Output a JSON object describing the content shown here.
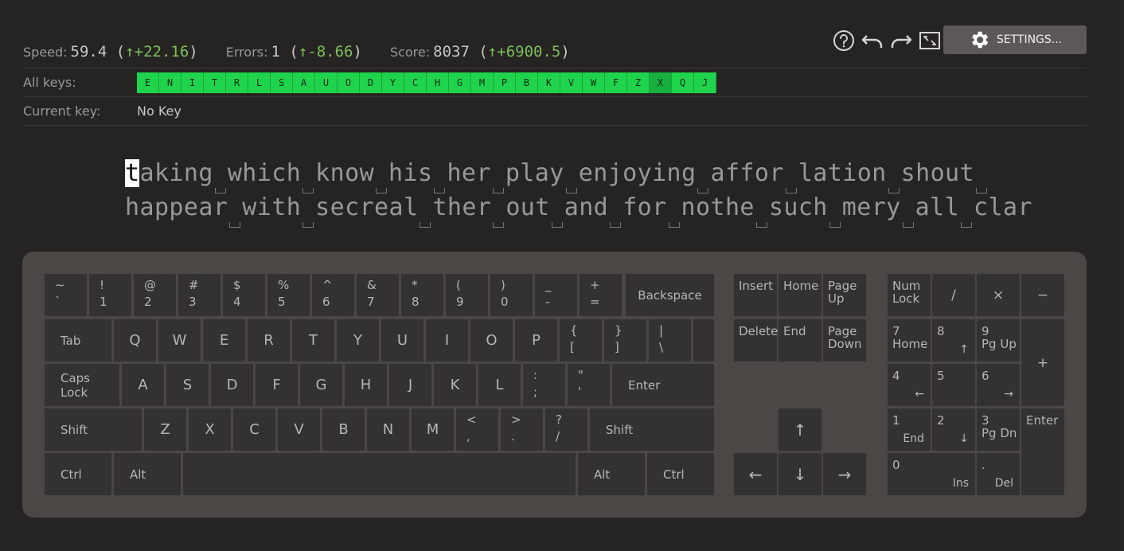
{
  "stats": {
    "speed_label": "Speed:",
    "speed_value": "59.4",
    "speed_delta": "+22.16",
    "errors_label": "Errors:",
    "errors_value": "1",
    "errors_delta": "-8.66",
    "score_label": "Score:",
    "score_value": "8037",
    "score_delta": "+6900.5"
  },
  "toolbar": {
    "help_icon": "help-circle-icon",
    "undo_icon": "undo-icon",
    "redo_icon": "redo-icon",
    "fullscreen_icon": "fullscreen-icon",
    "settings_label": "SETTINGS..."
  },
  "all_keys": {
    "label": "All keys:",
    "keys": [
      "E",
      "N",
      "I",
      "T",
      "R",
      "L",
      "S",
      "A",
      "U",
      "O",
      "D",
      "Y",
      "C",
      "H",
      "G",
      "M",
      "P",
      "B",
      "K",
      "V",
      "W",
      "F",
      "Z",
      "X",
      "Q",
      "J"
    ]
  },
  "current_key": {
    "label": "Current key:",
    "value": "No Key"
  },
  "lesson": {
    "cursor_char": "t",
    "line1": "aking which know his her play enjoying affor lation shout ",
    "line2": "happear with secreal ther out and for nothe such mery all clar"
  },
  "keyboard": {
    "row1": [
      [
        "~",
        "`"
      ],
      [
        "!",
        "1"
      ],
      [
        "@",
        "2"
      ],
      [
        "#",
        "3"
      ],
      [
        "$",
        "4"
      ],
      [
        "%",
        "5"
      ],
      [
        "^",
        "6"
      ],
      [
        "&",
        "7"
      ],
      [
        "*",
        "8"
      ],
      [
        "(",
        "9"
      ],
      [
        ")",
        "0"
      ],
      [
        "_",
        "-"
      ],
      [
        "+",
        "="
      ]
    ],
    "backspace": "Backspace",
    "tab": "Tab",
    "row2_letters": [
      "Q",
      "W",
      "E",
      "R",
      "T",
      "Y",
      "U",
      "I",
      "O",
      "P"
    ],
    "row2_symbols": [
      [
        "{",
        "["
      ],
      [
        "}",
        "]"
      ],
      [
        "|",
        "\\"
      ]
    ],
    "caps": "Caps Lock",
    "row3_letters": [
      "A",
      "S",
      "D",
      "F",
      "G",
      "H",
      "J",
      "K",
      "L"
    ],
    "row3_symbols": [
      [
        ":",
        ";"
      ],
      [
        "\"",
        "'"
      ]
    ],
    "enter": "Enter",
    "shift": "Shift",
    "row4_letters": [
      "Z",
      "X",
      "C",
      "V",
      "B",
      "N",
      "M"
    ],
    "row4_symbols": [
      [
        "<",
        ","
      ],
      [
        ">",
        "."
      ],
      [
        "?",
        "/"
      ]
    ],
    "ctrl": "Ctrl",
    "alt": "Alt",
    "nav": {
      "insert": "Insert",
      "home": "Home",
      "page_up": "Page Up",
      "delete": "Delete",
      "end": "End",
      "page_down": "Page Down"
    },
    "arrows": {
      "up": "↑",
      "left": "←",
      "down": "↓",
      "right": "→"
    },
    "numpad": {
      "num_lock": "Num Lock",
      "divide": "/",
      "multiply": "×",
      "minus": "−",
      "plus": "+",
      "enter": "Enter",
      "n7": "7",
      "n7b": "Home",
      "n8": "8",
      "n8b": "↑",
      "n9": "9",
      "n9b": "Pg Up",
      "n4": "4",
      "n4b": "←",
      "n5": "5",
      "n6": "6",
      "n6b": "→",
      "n1": "1",
      "n1b": "End",
      "n2": "2",
      "n2b": "↓",
      "n3": "3",
      "n3b": "Pg Dn",
      "n0": "0",
      "n0b": "Ins",
      "dot": ".",
      "dotb": "Del"
    }
  },
  "colors": {
    "key_ok": "#1fd44c",
    "delta_green": "#7fbf5a",
    "background": "#252423",
    "keyboard_bg": "#4a4745",
    "key_bg": "#333231"
  }
}
